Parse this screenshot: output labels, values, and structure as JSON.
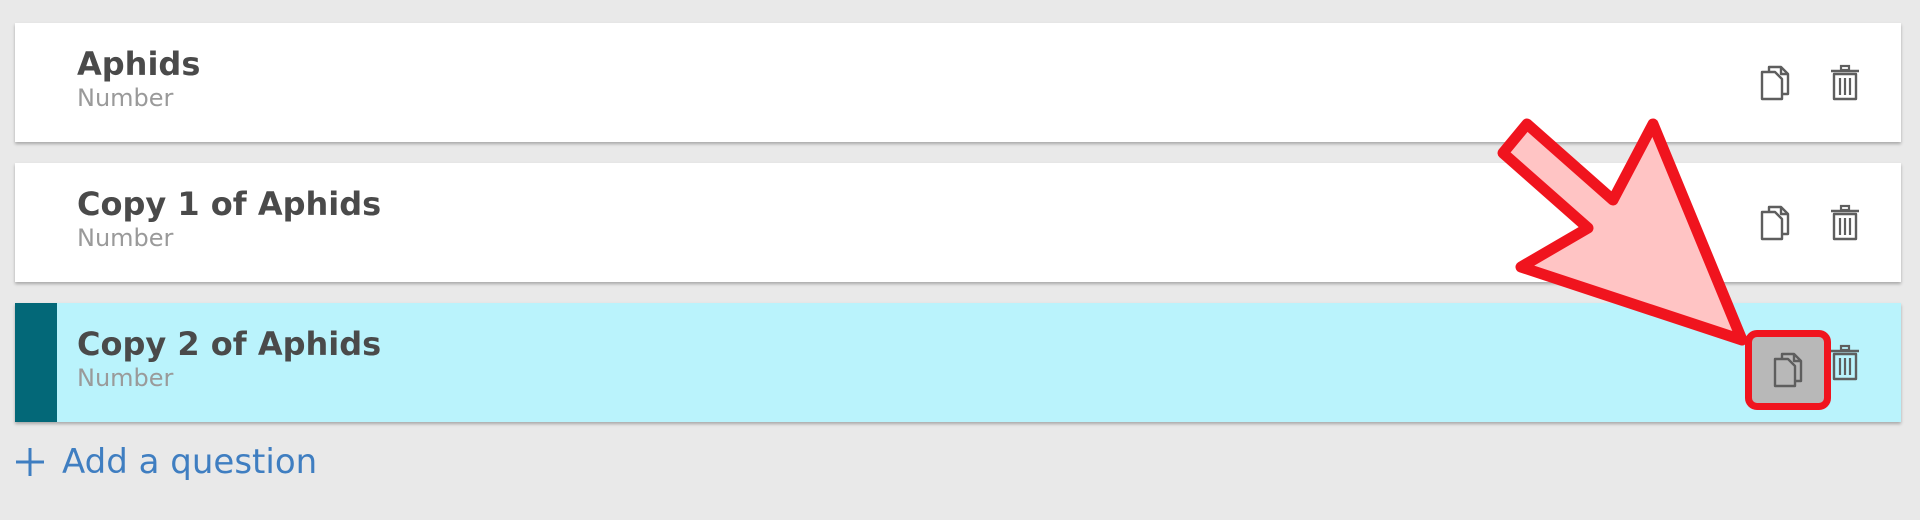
{
  "questions": [
    {
      "title": "Aphids",
      "type": "Number",
      "selected": false
    },
    {
      "title": "Copy 1 of Aphids",
      "type": "Number",
      "selected": false
    },
    {
      "title": "Copy 2 of Aphids",
      "type": "Number",
      "selected": true
    }
  ],
  "add_question": {
    "label": "Add a question"
  },
  "icons": {
    "copy": "copy-icon",
    "delete": "trash-icon",
    "add": "plus-icon"
  },
  "colors": {
    "background": "#e9e9e9",
    "card": "#ffffff",
    "selected_card": "#baf3fc",
    "selected_bar": "#036878",
    "link": "#3f7ec1",
    "annotation_stroke": "#f0141e",
    "annotation_fill": "#ffc4c4"
  }
}
